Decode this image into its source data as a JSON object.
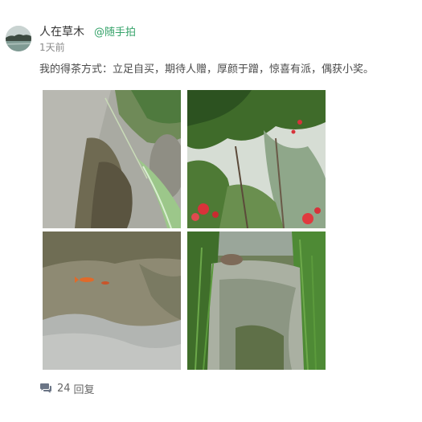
{
  "post": {
    "author": "人在草木",
    "topic": "@随手拍",
    "time": "1天前",
    "text": "我的得茶方式：立足自买，期待人赠，厚颜于蹭，惊喜有派，偶获小奖。",
    "photos": [
      "pond-reflection-leaf",
      "flowering-tree",
      "goldfish-pond",
      "garden-pond-reeds"
    ]
  },
  "footer": {
    "reply_count": "24",
    "reply_label": "回复",
    "icon": "comment-icon"
  },
  "colors": {
    "topic": "#36a36a",
    "text": "#4a4a4a",
    "meta": "#8a8a8a"
  }
}
